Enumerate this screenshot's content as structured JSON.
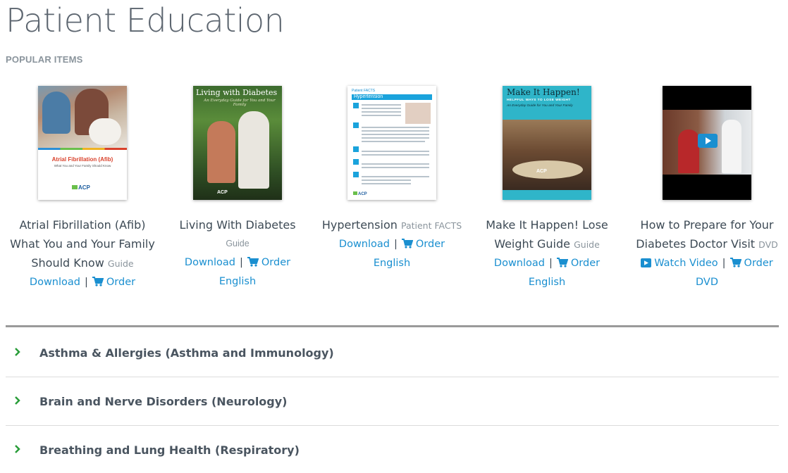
{
  "page": {
    "title": "Patient Education",
    "section_label": "POPULAR ITEMS"
  },
  "items": [
    {
      "title": "Atrial Fibrillation (Afib) What You and Your Family Should Know",
      "type": "Guide",
      "links": {
        "download": "Download",
        "order": "Order"
      },
      "language": "",
      "cover": {
        "heading": "Atrial Fibrillation (Afib)",
        "subheading": "What You and Your Family Should Know",
        "logo": "ACP"
      }
    },
    {
      "title": "Living With Diabetes",
      "type": "Guide",
      "links": {
        "download": "Download",
        "order": "Order"
      },
      "language": "English",
      "cover": {
        "heading": "Living with Diabetes",
        "subheading": "An Everyday Guide for You and Your Family",
        "logo": "ACP"
      }
    },
    {
      "title": "Hypertension",
      "type": "Patient FACTS",
      "links": {
        "download": "Download",
        "order": "Order"
      },
      "language": "English",
      "cover": {
        "kicker": "Patient FACTS",
        "heading": "Hypertension",
        "logo": "ACP"
      }
    },
    {
      "title": "Make It Happen! Lose Weight Guide",
      "type": "Guide",
      "links": {
        "download": "Download",
        "order": "Order"
      },
      "language": "English",
      "cover": {
        "heading": "Make It Happen!",
        "subheading": "HELPFUL WAYS TO LOSE WEIGHT",
        "tagline": "An Everyday Guide for You and Your Family",
        "logo": "ACP"
      }
    },
    {
      "title": "How to Prepare for Your Diabetes Doctor Visit",
      "type": "DVD",
      "links": {
        "watch": "Watch Video",
        "order": "Order"
      },
      "language": "DVD"
    }
  ],
  "accordion": [
    {
      "label": "Asthma & Allergies (Asthma and Immunology)"
    },
    {
      "label": "Brain and Nerve Disorders (Neurology)"
    },
    {
      "label": "Breathing and Lung Health (Respiratory)"
    }
  ],
  "colors": {
    "link": "#1a8fd0",
    "chevron": "#2a9d3a",
    "divider": "#9a9a9a"
  },
  "icons": {
    "cart": "cart-icon",
    "video": "video-play-icon",
    "chevron": "chevron-right-icon"
  }
}
